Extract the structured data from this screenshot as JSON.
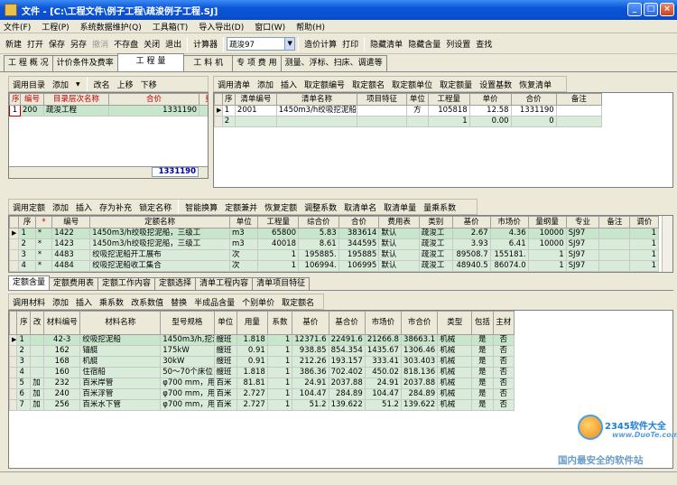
{
  "window": {
    "title": "文件 - [C:\\工程文件\\例子工程\\疏浚例子工程.SJ]",
    "minimize": "_",
    "maximize": "□",
    "close": "×"
  },
  "menu": [
    "文件(F)",
    "工程(P)",
    "系统数据维护(Q)",
    "工具箱(T)",
    "导入导出(D)",
    "窗口(W)",
    "帮助(H)"
  ],
  "toolbar": {
    "items": [
      "新建",
      "打开",
      "保存",
      "另存",
      "撤消",
      "不存盘",
      "关闭",
      "退出",
      "计算器"
    ],
    "disabled": "撤消",
    "combo_value": "疏浚97",
    "items2": [
      "造价计算",
      "打印",
      "隐藏清单",
      "隐藏含量",
      "列设置",
      "查找"
    ]
  },
  "tabs": [
    "工 程 概 况",
    "计价条件及费率",
    "工 程 量",
    "工 料 机",
    "专 项 费 用",
    "测量、浮标、扫床、调遣等"
  ],
  "selected_tab": "工 程 量",
  "dir_panel": {
    "toolbar": [
      "调用目录",
      "添加",
      "▼",
      "改名",
      "上移",
      "下移"
    ],
    "columns": [
      "序",
      "编号",
      "目录层次名称",
      "合价",
      "费"
    ],
    "rows": [
      {
        "seq": "1",
        "code": "200",
        "name": "疏浚工程",
        "total": "1331190"
      }
    ],
    "total": "1331190"
  },
  "list_panel": {
    "toolbar": [
      "调用清单",
      "添加",
      "插入",
      "取定额编号",
      "取定额名",
      "取定额单位",
      "取定额量",
      "设置基数",
      "恢复清单"
    ],
    "columns": [
      "序",
      "清单编号",
      "清单名称",
      "项目特征",
      "单位",
      "工程量",
      "单价",
      "合价",
      "备注"
    ],
    "rows": [
      {
        "seq": "1",
        "code": "2001",
        "name": "1450m3/h绞吸挖泥船，三级工",
        "feature": "",
        "unit": "方",
        "qty": "105818",
        "price": "12.58",
        "total": "1331190",
        "note": ""
      },
      {
        "seq": "2",
        "code": "",
        "name": "",
        "feature": "",
        "unit": "",
        "qty": "1",
        "price": "0.00",
        "total": "0",
        "note": ""
      }
    ]
  },
  "quota_panel": {
    "toolbar": [
      "调用定额",
      "添加",
      "插入",
      "存为补充",
      "锁定名称",
      "智能换算",
      "定额兼并",
      "恢复定额",
      "调整系数",
      "取清单名",
      "取清单量",
      "量乘系数"
    ],
    "columns": [
      "序",
      "*",
      "编号",
      "定额名称",
      "单位",
      "工程量",
      "综合价",
      "合价",
      "费用表",
      "类别",
      "基价",
      "市场价",
      "量纲量",
      "专业",
      "备注",
      "调价"
    ],
    "rows": [
      {
        "seq": "1",
        "mark": "*",
        "code": "1422",
        "name": "1450m3/h绞吸挖泥船，三级工",
        "unit": "m3",
        "qty": "65800",
        "uprice": "5.83",
        "total": "383614",
        "fee": "默认",
        "cat": "疏浚工",
        "base": "2.67",
        "market": "4.36",
        "dim": "10000",
        "pro": "SJ97",
        "note": "",
        "adj": "1"
      },
      {
        "seq": "2",
        "mark": "*",
        "code": "1423",
        "name": "1450m3/h绞吸挖泥船，三级工",
        "unit": "m3",
        "qty": "40018",
        "uprice": "8.61",
        "total": "344595",
        "fee": "默认",
        "cat": "疏浚工",
        "base": "3.93",
        "market": "6.41",
        "dim": "10000",
        "pro": "SJ97",
        "note": "",
        "adj": "1"
      },
      {
        "seq": "3",
        "mark": "*",
        "code": "4483",
        "name": "绞吸挖泥船开工展布",
        "unit": "次",
        "qty": "1",
        "uprice": "195885.",
        "total": "195885",
        "fee": "默认",
        "cat": "疏浚工",
        "base": "89508.7",
        "market": "155181.",
        "dim": "1",
        "pro": "SJ97",
        "note": "",
        "adj": "1"
      },
      {
        "seq": "4",
        "mark": "*",
        "code": "4484",
        "name": "绞吸挖泥船收工集合",
        "unit": "次",
        "qty": "1",
        "uprice": "106994.",
        "total": "106995",
        "fee": "默认",
        "cat": "疏浚工",
        "base": "48940.5",
        "market": "86074.0",
        "dim": "1",
        "pro": "SJ97",
        "note": "",
        "adj": "1"
      }
    ]
  },
  "sub_tabs": [
    "定额含量",
    "定额费用表",
    "定额工作内容",
    "定额选择",
    "清单工程内容",
    "清单项目特征"
  ],
  "material_panel": {
    "toolbar": [
      "调用材料",
      "添加",
      "插入",
      "乘系数",
      "改系数值",
      "替换",
      "半成品含量",
      "个别单价",
      "取定额名"
    ],
    "columns": [
      "序",
      "改",
      "材料编号",
      "材料名称",
      "型号规格",
      "单位",
      "用量",
      "系数",
      "基价",
      "基合价",
      "市场价",
      "市合价",
      "类型",
      "包括",
      "主材"
    ],
    "rows": [
      {
        "seq": "1",
        "mod": "",
        "code": "42-3",
        "name": "绞吸挖泥船",
        "spec": "1450m3/h,挖泥",
        "unit": "艘班",
        "qty": "1.818",
        "coef": "1",
        "base": "12371.6",
        "basetot": "22491.6",
        "market": "21266.8",
        "markettot": "38663.1",
        "type": "机械",
        "inc": "是",
        "main": "否"
      },
      {
        "seq": "2",
        "mod": "",
        "code": "162",
        "name": "锚艇",
        "spec": "175kW",
        "unit": "艘班",
        "qty": "0.91",
        "coef": "1",
        "base": "938.85",
        "basetot": "854.354",
        "market": "1435.67",
        "markettot": "1306.46",
        "type": "机械",
        "inc": "是",
        "main": "否"
      },
      {
        "seq": "3",
        "mod": "",
        "code": "168",
        "name": "机艇",
        "spec": "30kW",
        "unit": "艘班",
        "qty": "0.91",
        "coef": "1",
        "base": "212.26",
        "basetot": "193.157",
        "market": "333.41",
        "markettot": "303.403",
        "type": "机械",
        "inc": "是",
        "main": "否"
      },
      {
        "seq": "4",
        "mod": "",
        "code": "160",
        "name": "住宿船",
        "spec": "50～70个床位",
        "unit": "艘班",
        "qty": "1.818",
        "coef": "1",
        "base": "386.36",
        "basetot": "702.402",
        "market": "450.02",
        "markettot": "818.136",
        "type": "机械",
        "inc": "是",
        "main": "否"
      },
      {
        "seq": "5",
        "mod": "加",
        "code": "232",
        "name": "百米岸管",
        "spec": "φ700 mm，用三",
        "unit": "百米",
        "qty": "81.81",
        "coef": "1",
        "base": "24.91",
        "basetot": "2037.88",
        "market": "24.91",
        "markettot": "2037.88",
        "type": "机械",
        "inc": "是",
        "main": "否"
      },
      {
        "seq": "6",
        "mod": "加",
        "code": "240",
        "name": "百米浮管",
        "spec": "φ700 mm，用三",
        "unit": "百米",
        "qty": "2.727",
        "coef": "1",
        "base": "104.47",
        "basetot": "284.89",
        "market": "104.47",
        "markettot": "284.89",
        "type": "机械",
        "inc": "是",
        "main": "否"
      },
      {
        "seq": "7",
        "mod": "加",
        "code": "256",
        "name": "百米水下管",
        "spec": "φ700 mm，用三",
        "unit": "百米",
        "qty": "2.727",
        "coef": "1",
        "base": "51.2",
        "basetot": "139.622",
        "market": "51.2",
        "markettot": "139.622",
        "type": "机械",
        "inc": "是",
        "main": "否"
      }
    ]
  },
  "watermark": {
    "brand": "2345软件大全",
    "url": "www.DuoTe.com",
    "slogan": "国内最安全的软件站"
  },
  "colors": {
    "title_blue": "#0a4fcf",
    "row_green": "#d9ecd9",
    "header_red": "#c00000"
  }
}
